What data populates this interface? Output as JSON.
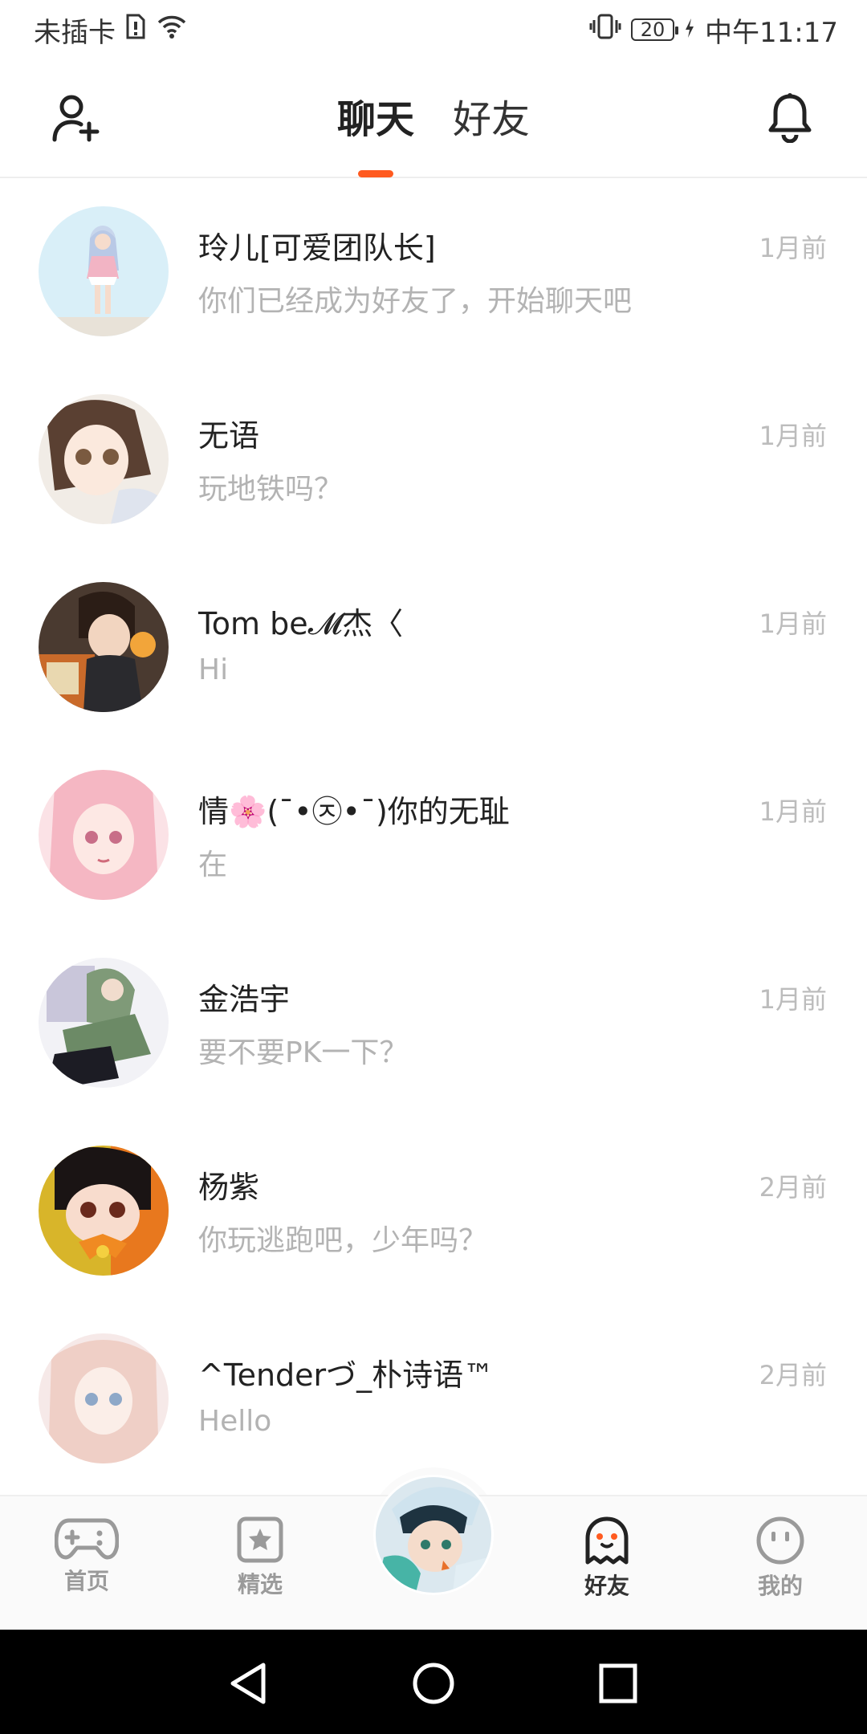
{
  "status_bar": {
    "carrier": "未插卡",
    "battery_level": "20",
    "time": "中午11:17"
  },
  "header": {
    "tabs": [
      {
        "label": "聊天",
        "active": true
      },
      {
        "label": "好友",
        "active": false
      }
    ]
  },
  "chats": [
    {
      "name": "玲儿[可爱团队长]",
      "message": "你们已经成为好友了，开始聊天吧",
      "time": "1月前"
    },
    {
      "name": "无语",
      "message": "玩地铁吗？",
      "time": "1月前"
    },
    {
      "name": "Tom be𝓜杰〈",
      "message": "Hi",
      "time": "1月前"
    },
    {
      "name": "情🌸(¯•㉨•¯)你的无耻",
      "message": "在",
      "time": "1月前"
    },
    {
      "name": "金浩宇",
      "message": " 要不要PK一下？",
      "time": "1月前"
    },
    {
      "name": "杨紫",
      "message": "你玩逃跑吧，少年吗？",
      "time": "2月前"
    },
    {
      "name": "^Tenderづ_朴诗语™",
      "message": "Hello",
      "time": "2月前"
    }
  ],
  "bottom_nav": {
    "items": [
      {
        "label": "首页",
        "icon": "gamepad-icon"
      },
      {
        "label": "精选",
        "icon": "star-card-icon"
      },
      {
        "label": "好友",
        "icon": "ghost-icon",
        "active": true
      },
      {
        "label": "我的",
        "icon": "smiley-icon"
      }
    ],
    "accent": "#ff5a1f"
  }
}
